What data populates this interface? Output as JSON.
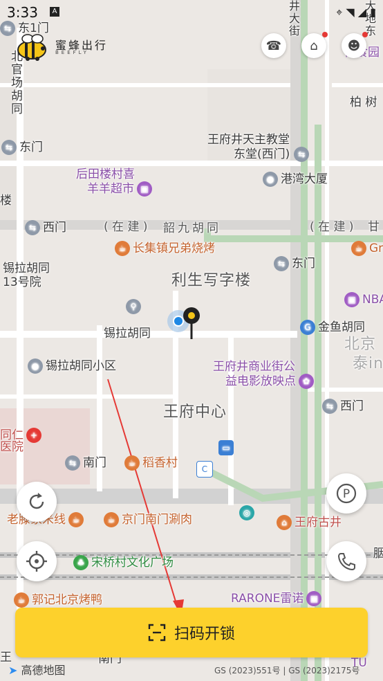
{
  "status_bar": {
    "time": "3:33",
    "a_badge": "A"
  },
  "brand": {
    "name": "蜜蜂出行",
    "sub": "BEEFLY"
  },
  "map_labels": {
    "dong1men": "东1门",
    "jingshan": "井大街",
    "dongsi": "大地东",
    "yushiyuan": "御食园",
    "beiguan": "北官场胡同",
    "baishu": "柏 树",
    "wangfujing_church": "王府井天主教堂",
    "dongtang": "东堂(西门)",
    "dongmen1": "东门",
    "houtianlou": "后田楼村喜",
    "yangyang": "羊羊超市",
    "gangwan": "港湾大厦",
    "lou": "楼",
    "ximen1": "西门",
    "zaijian1": "( 在 建 )",
    "shaojiu": "韶九胡同",
    "zaijian2": "( 在 建 )",
    "gan": "甘",
    "changjizhen": "长集镇兄弟烧烤",
    "gr": "Gr",
    "xila13": "锡拉胡同",
    "xila13b": "13号院",
    "lisheng": "利生写字楼",
    "dongmen2": "东门",
    "nba": "NBA",
    "xilahutong": "锡拉胡同",
    "jinyu": "金鱼胡同",
    "beijing": "北京",
    "tai": "泰in",
    "xilaxiaoqu": "锡拉胡同小区",
    "wfj_commercial": "王府井商业街公",
    "yidian": "益电影放映点",
    "wfj_center": "王府中心",
    "ximen2": "西门",
    "tongren": "同仁",
    "yiyuan": "医院",
    "nanmen": "南门",
    "daoxiangcun": "稻香村",
    "laotengjia": "老滕家米线",
    "jingmen": "京门南门涮肉",
    "wfj_guxin": "王府古井",
    "songqiao": "宋桥村文化广场",
    "guoji": "郭记北京烤鸭",
    "rarone": "RARONE雷诺",
    "wang": "王",
    "nanmen2": "南门",
    "tu": "TU",
    "hu": "胭"
  },
  "scan_button": {
    "label": "扫码开锁"
  },
  "footer": {
    "amap": "高德地图",
    "gs": "GS (2023)551号 | GS (2023)2175号"
  },
  "colors": {
    "accent": "#fdd12c",
    "road": "#ffffff",
    "block": "#ece8e4",
    "transit": "#b9d7b6"
  }
}
